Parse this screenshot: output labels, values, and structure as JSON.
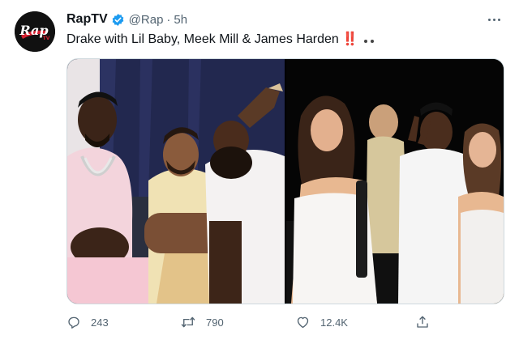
{
  "account": {
    "display_name": "RapTV",
    "handle": "@Rap",
    "separator": "·",
    "timestamp": "5h",
    "verified": true,
    "avatar_icon": "rap-tv-logo",
    "avatar_logo_text": "Rap",
    "avatar_logo_subtext": "TV"
  },
  "tweet": {
    "text": "Drake with Lil Baby, Meek Mill & James Harden",
    "emphasis": "‼️",
    "trailing_icon": "ellipsis-dots"
  },
  "media": {
    "photos": [
      {
        "icon": "group-photo-left"
      },
      {
        "icon": "group-photo-right"
      }
    ]
  },
  "actions": {
    "reply": {
      "icon": "reply-icon",
      "count": "243"
    },
    "retweet": {
      "icon": "retweet-icon",
      "count": "790"
    },
    "like": {
      "icon": "heart-icon",
      "count": "12.4K"
    },
    "share": {
      "icon": "share-icon"
    }
  },
  "colors": {
    "text": "#0f1419",
    "secondary": "#536471",
    "verified_blue": "#1d9bf0",
    "emphasis_red": "#cc1e2e",
    "border": "#cfd9de"
  }
}
